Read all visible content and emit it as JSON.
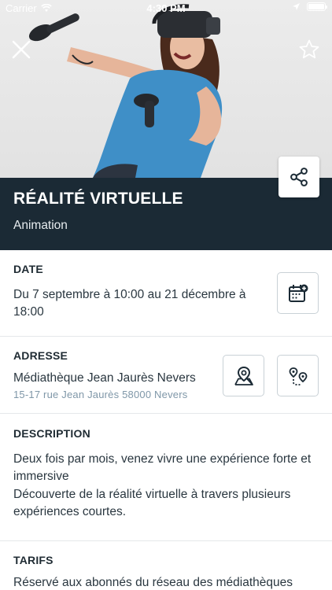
{
  "status_bar": {
    "carrier": "Carrier",
    "time": "4:30 PM"
  },
  "header": {
    "title": "RÉALITÉ VIRTUELLE",
    "subtitle": "Animation"
  },
  "date": {
    "label": "DATE",
    "text": "Du 7 septembre à 10:00 au 21 décembre à 18:00"
  },
  "address": {
    "label": "ADRESSE",
    "name": "Médiathèque Jean Jaurès Nevers",
    "street": "15-17 rue Jean Jaurès 58000 Nevers"
  },
  "description": {
    "label": "DESCRIPTION",
    "line1": "Deux fois par mois, venez vivre une expérience forte et immersive",
    "line2": "Découverte de la réalité virtuelle à travers plusieurs expériences courtes."
  },
  "tarifs": {
    "label": "TARIFS",
    "text": "Réservé aux abonnés du réseau des médiathèques"
  },
  "colors": {
    "header_bg": "#1b2a35",
    "accent_text": "#7f97a8",
    "border": "#c9d1d6"
  },
  "icons": {
    "close": "close-icon",
    "favorite": "star-icon",
    "share": "share-icon",
    "calendar": "calendar-add-icon",
    "map": "map-pin-icon",
    "route": "route-icon"
  }
}
